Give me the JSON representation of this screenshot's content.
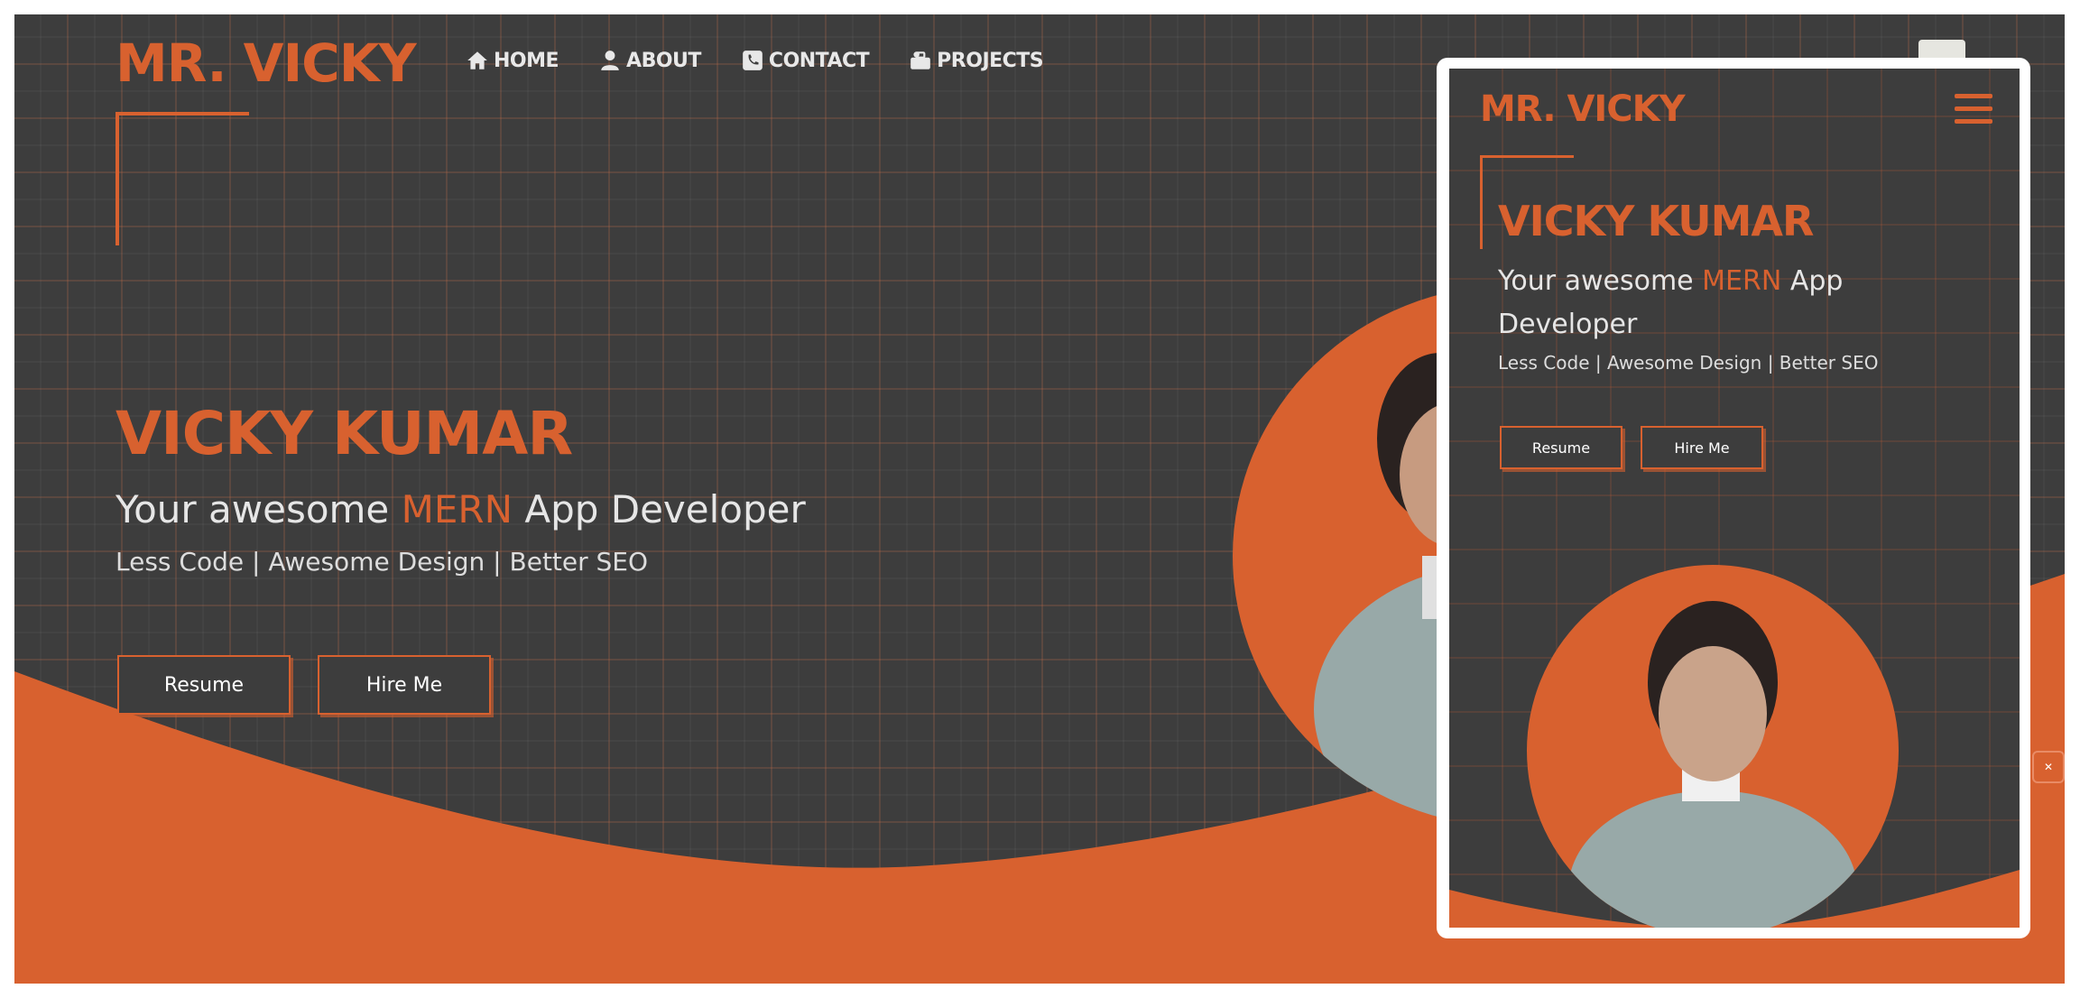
{
  "colors": {
    "accent": "#d8612f",
    "background": "#3d3d3d",
    "text": "#e6e6e6"
  },
  "desktop": {
    "logo": "MR. VICKY",
    "nav": [
      {
        "label": "HOME",
        "icon": "home-icon"
      },
      {
        "label": "ABOUT",
        "icon": "user-icon"
      },
      {
        "label": "CONTACT",
        "icon": "phone-icon"
      },
      {
        "label": "PROJECTS",
        "icon": "briefcase-icon"
      }
    ],
    "hero": {
      "name": "VICKY KUMAR",
      "tagline_prefix": "Your awesome ",
      "tagline_accent": "MERN",
      "tagline_suffix": " App Developer",
      "subtitle": "Less Code | Awesome Design | Better SEO",
      "resume_label": "Resume",
      "hire_label": "Hire Me"
    }
  },
  "mobile": {
    "logo": "MR. VICKY",
    "hero": {
      "name": "VICKY KUMAR",
      "tagline_prefix": "Your awesome ",
      "tagline_accent": "MERN",
      "tagline_suffix": " App Developer",
      "subtitle": "Less Code | Awesome Design | Better SEO",
      "resume_label": "Resume",
      "hire_label": "Hire Me"
    }
  }
}
